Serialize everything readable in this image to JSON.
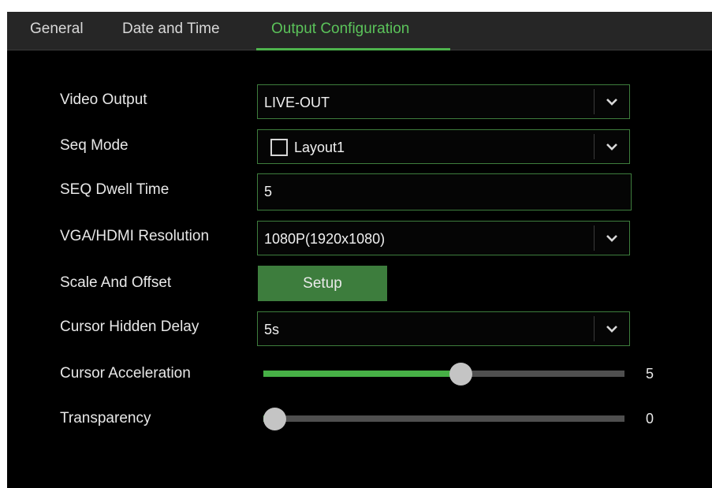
{
  "tabs": {
    "general": "General",
    "date_time": "Date and Time",
    "output_configuration": "Output Configuration",
    "active": "Output Configuration"
  },
  "form": {
    "video_output": {
      "label": "Video Output",
      "value": "LIVE-OUT"
    },
    "seq_mode": {
      "label": "Seq Mode",
      "option_label": "Layout1",
      "checked": false
    },
    "seq_dwell_time": {
      "label": "SEQ Dwell Time",
      "value": "5"
    },
    "resolution": {
      "label": "VGA/HDMI Resolution",
      "value": "1080P(1920x1080)"
    },
    "scale_offset": {
      "label": "Scale And Offset",
      "button_label": "Setup"
    },
    "cursor_hidden_delay": {
      "label": "Cursor Hidden Delay",
      "value": "5s"
    },
    "cursor_acceleration": {
      "label": "Cursor Acceleration",
      "value": "5",
      "fraction": 0.55
    },
    "transparency": {
      "label": "Transparency",
      "value": "0",
      "fraction": 0.0
    }
  },
  "icons": {
    "dropdown": "chevron-down-icon",
    "slider_thumb": "slider-thumb"
  },
  "colors": {
    "accent": "#5bc35a",
    "button": "#3d7d3d",
    "border": "#3e7d3d",
    "slider_fill": "#47b046",
    "background": "#000000",
    "tab_bar": "#262626"
  }
}
